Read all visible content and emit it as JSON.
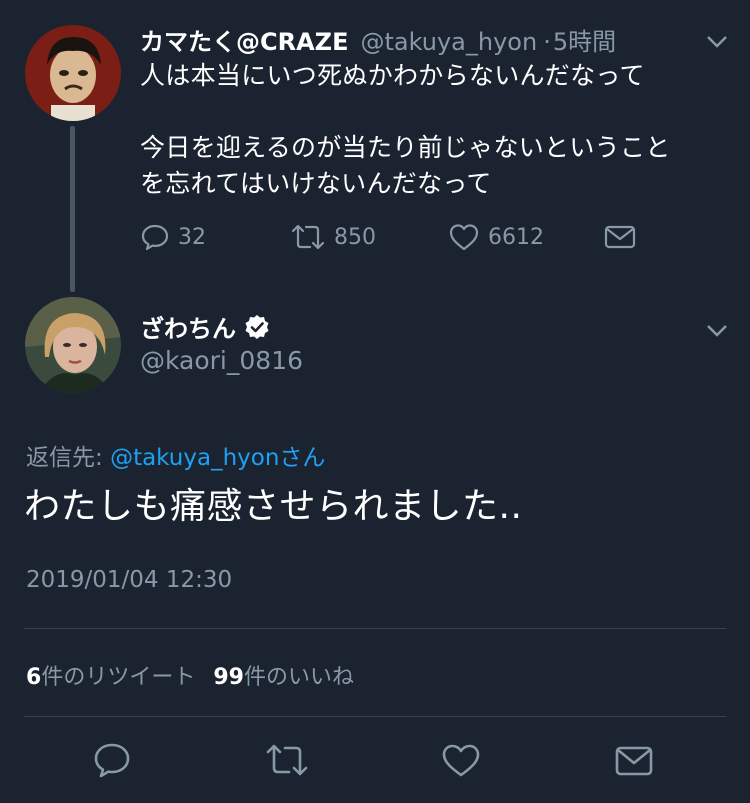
{
  "parent_tweet": {
    "display_name": "カマたく@CRAZE",
    "handle": "@takuya_hyon",
    "time": "5時間",
    "time_separator": "·",
    "text_line1": "人は本当にいつ死ぬかわからないんだなって",
    "text_line2": "今日を迎えるのが当たり前じゃないということ",
    "text_line3": "を忘れてはいけないんだなって",
    "reply_count": "32",
    "retweet_count": "850",
    "like_count": "6612"
  },
  "main_tweet": {
    "display_name": "ざわちん",
    "handle": "@kaori_0816",
    "reply_to_label": "返信先: ",
    "reply_to_handle": "@takuya_hyon",
    "reply_to_suffix": "さん",
    "text": "わたしも痛感させられました..",
    "timestamp": "2019/01/04 12:30",
    "retweet_count": "6",
    "retweet_label": "件のリツイート",
    "like_count": "99",
    "like_label": "件のいいね"
  },
  "colors": {
    "background": "#1b2330",
    "muted": "#8899a6",
    "link": "#1da1f2",
    "divider": "#38444d"
  },
  "icons": {
    "parent_actions": [
      "reply-icon",
      "retweet-icon",
      "like-icon",
      "dm-icon"
    ],
    "main_actions": [
      "reply-icon",
      "retweet-icon",
      "like-icon",
      "dm-icon"
    ]
  }
}
